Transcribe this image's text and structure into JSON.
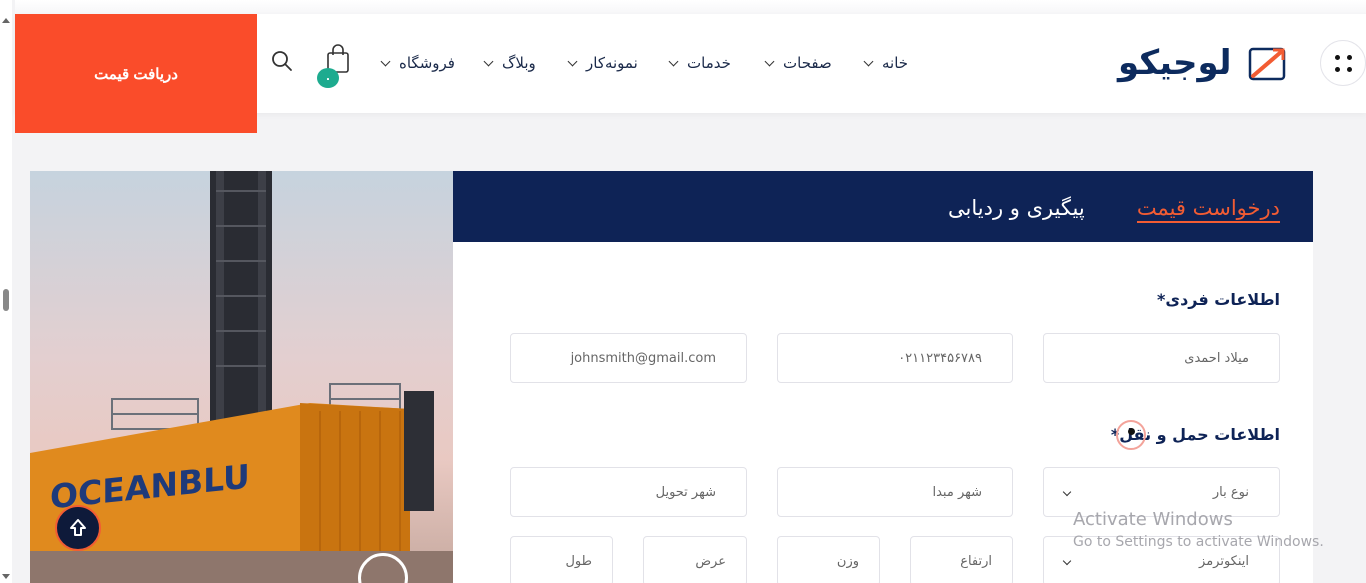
{
  "header": {
    "quote_button": "دریافت قیمت",
    "cart_count": "۰",
    "logo": "لوجیکو",
    "nav": [
      {
        "label": "خانه"
      },
      {
        "label": "صفحات"
      },
      {
        "label": "خدمات"
      },
      {
        "label": "نمونه‌کار"
      },
      {
        "label": "وبلاگ"
      },
      {
        "label": "فروشگاه"
      }
    ]
  },
  "hero": {
    "container_text": "OCEANBLU"
  },
  "tabs": {
    "active": "درخواست قیمت",
    "inactive": "پیگیری و ردیابی"
  },
  "personal": {
    "title": "اطلاعات فردی*",
    "name_placeholder": "میلاد احمدی",
    "phone_placeholder": "۰۲۱۱۲۳۴۵۶۷۸۹",
    "email_placeholder": "johnsmith@gmail.com"
  },
  "transport": {
    "title": "اطلاعات حمل و نقل*",
    "cargo_type": "نوع بار",
    "origin_city": "شهر مبدا",
    "destination_city": "شهر تحویل",
    "incoterms": "اینکوترمز",
    "height": "ارتفاع",
    "weight": "وزن",
    "width": "عرض",
    "length": "طول"
  },
  "watermark": {
    "line1": "Activate Windows",
    "line2": "Go to Settings to activate Windows."
  },
  "colors": {
    "accent": "#fa4c2a",
    "navy": "#0e2356",
    "badge": "#1dab8f"
  }
}
